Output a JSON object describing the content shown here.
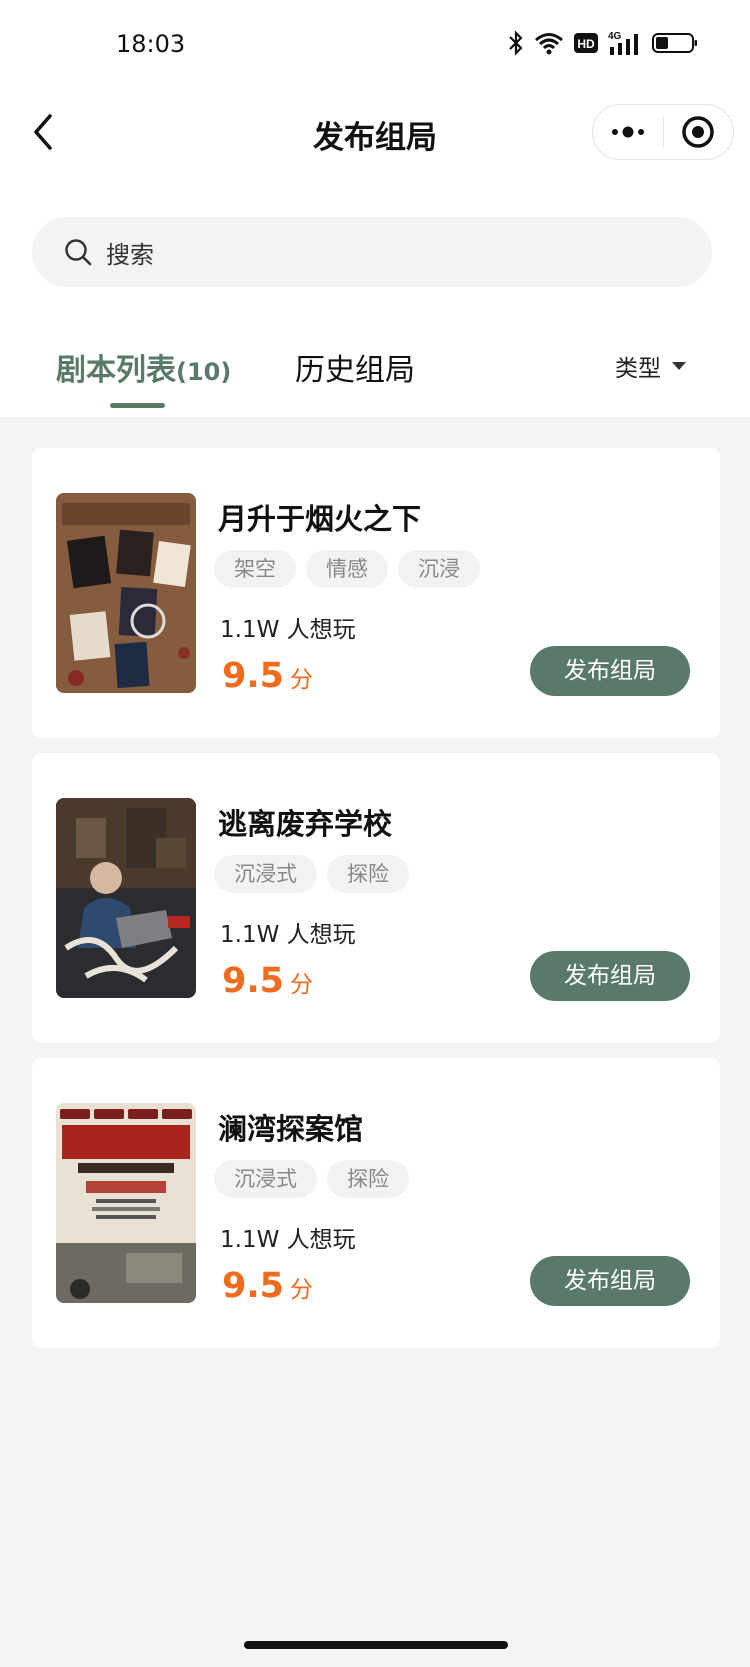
{
  "status_bar": {
    "time": "18:03",
    "network": "4G"
  },
  "nav": {
    "title": "发布组局"
  },
  "search": {
    "placeholder": "搜索"
  },
  "tabs": {
    "active_label": "剧本列表",
    "active_count": "(10)",
    "history_label": "历史组局",
    "filter_label": "类型"
  },
  "scripts": [
    {
      "title": "月升于烟火之下",
      "tags": [
        "架空",
        "情感",
        "沉浸"
      ],
      "wanted": "1.1W 人想玩",
      "score": "9.5",
      "score_unit": "分",
      "button": "发布组局"
    },
    {
      "title": "逃离废弃学校",
      "tags": [
        "沉浸式",
        "探险"
      ],
      "wanted": "1.1W 人想玩",
      "score": "9.5",
      "score_unit": "分",
      "button": "发布组局"
    },
    {
      "title": "澜湾探案馆",
      "tags": [
        "沉浸式",
        "探险"
      ],
      "wanted": "1.1W 人想玩",
      "score": "9.5",
      "score_unit": "分",
      "button": "发布组局"
    }
  ],
  "colors": {
    "accent": "#5a7a69",
    "score": "#f26a1b",
    "background": "#f4f4f4"
  },
  "icons": [
    "bluetooth-icon",
    "wifi-icon",
    "hd-icon",
    "cellular-icon",
    "battery-icon",
    "back-icon",
    "more-icon",
    "target-icon",
    "search-icon",
    "dropdown-icon"
  ]
}
